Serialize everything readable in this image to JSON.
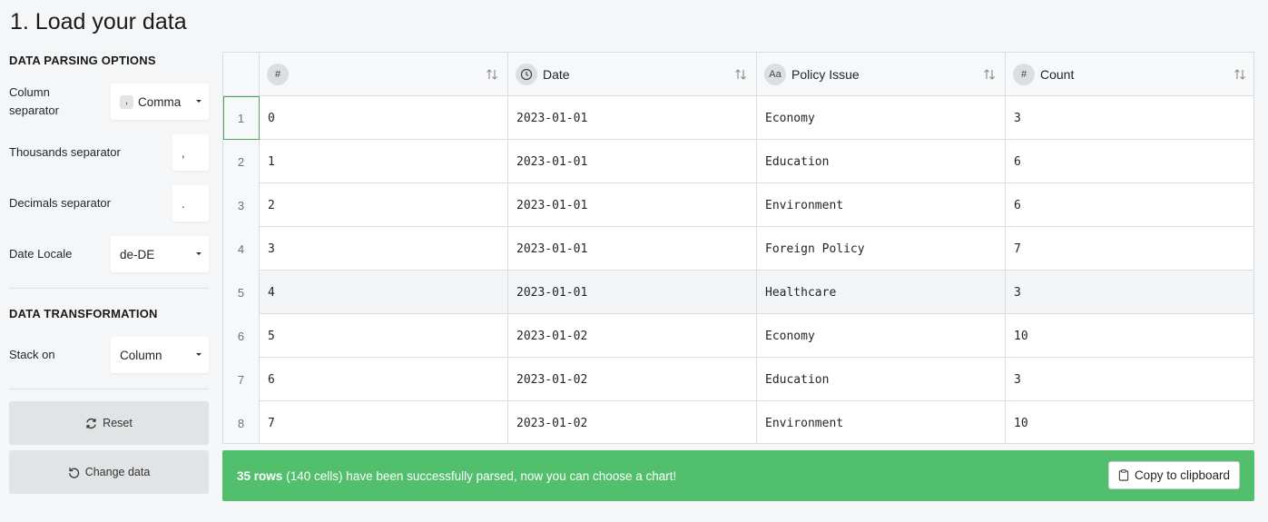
{
  "page": {
    "title": "1. Load your data"
  },
  "parsing": {
    "section_title": "DATA PARSING OPTIONS",
    "column_separator": {
      "label_line1": "Column",
      "label_line2": "separator",
      "chip": ",",
      "value": "Comma"
    },
    "thousands_separator": {
      "label": "Thousands separator",
      "value": ","
    },
    "decimals_separator": {
      "label": "Decimals separator",
      "value": "."
    },
    "date_locale": {
      "label": "Date Locale",
      "value": "de-DE"
    }
  },
  "transformation": {
    "section_title": "DATA TRANSFORMATION",
    "stack_on": {
      "label": "Stack on",
      "value": "Column"
    }
  },
  "buttons": {
    "reset": "Reset",
    "change_data": "Change data"
  },
  "grid": {
    "columns": [
      {
        "type_icon": "#",
        "label": "#"
      },
      {
        "type_icon": "clock-icon",
        "label": "Date"
      },
      {
        "type_icon": "Aa",
        "label": "Policy Issue"
      },
      {
        "type_icon": "#",
        "label": "Count"
      }
    ],
    "rows": [
      {
        "n": "1",
        "c0": "0",
        "c1": "2023-01-01",
        "c2": "Economy",
        "c3": "3"
      },
      {
        "n": "2",
        "c0": "1",
        "c1": "2023-01-01",
        "c2": "Education",
        "c3": "6"
      },
      {
        "n": "3",
        "c0": "2",
        "c1": "2023-01-01",
        "c2": "Environment",
        "c3": "6"
      },
      {
        "n": "4",
        "c0": "3",
        "c1": "2023-01-01",
        "c2": "Foreign Policy",
        "c3": "7"
      },
      {
        "n": "5",
        "c0": "4",
        "c1": "2023-01-01",
        "c2": "Healthcare",
        "c3": "3"
      },
      {
        "n": "6",
        "c0": "5",
        "c1": "2023-01-02",
        "c2": "Economy",
        "c3": "10"
      },
      {
        "n": "7",
        "c0": "6",
        "c1": "2023-01-02",
        "c2": "Education",
        "c3": "3"
      },
      {
        "n": "8",
        "c0": "7",
        "c1": "2023-01-02",
        "c2": "Environment",
        "c3": "10"
      }
    ]
  },
  "status": {
    "rows_bold": "35 rows",
    "message": "(140 cells) have been successfully parsed, now you can choose a chart!",
    "copy_label": "Copy to clipboard",
    "color": "#52bf6d"
  }
}
